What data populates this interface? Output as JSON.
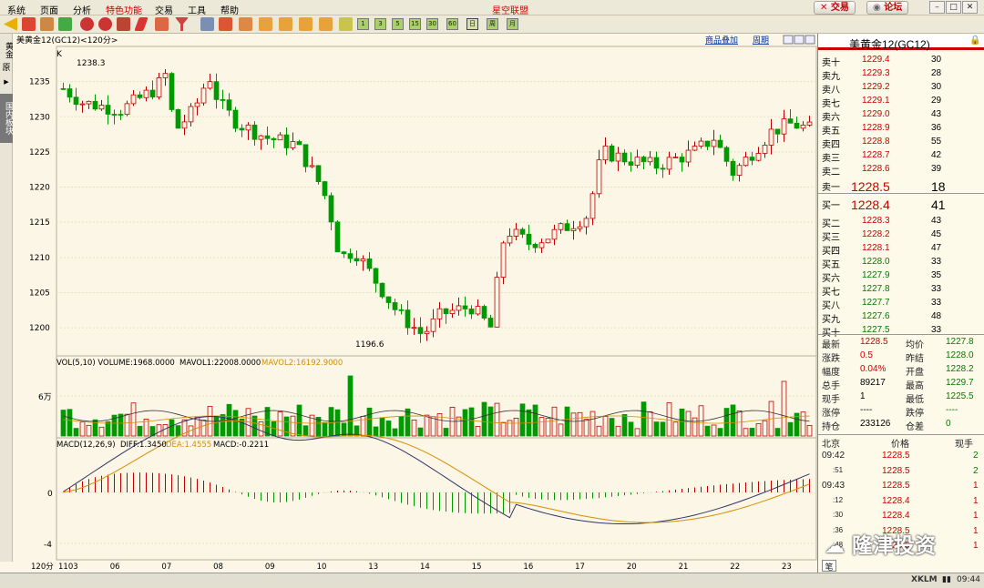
{
  "menu": {
    "items": [
      "系统",
      "页面",
      "分析",
      "特色功能",
      "交易",
      "工具",
      "帮助"
    ],
    "title": "星空联盟",
    "trade_btn": "交易",
    "forum_btn": "论坛"
  },
  "toolbar": {
    "periods": [
      "1",
      "3",
      "5",
      "15",
      "30",
      "60",
      "日",
      "周",
      "月"
    ]
  },
  "left_tabs": {
    "tab1": "黄金",
    "tab2": "原",
    "tab3": "国内板块"
  },
  "chart_header": {
    "title": "美黄金12(GC12)<120分>",
    "overlay": "商品叠加",
    "period": "周期",
    "k_label": "K"
  },
  "chart_data": [
    {
      "type": "candlestick",
      "title": "美黄金12(GC12)<120分>",
      "ylim": [
        1196,
        1240
      ],
      "yticks": [
        1200,
        1205,
        1210,
        1215,
        1220,
        1225,
        1230,
        1235
      ],
      "high_label": "1238.3",
      "low_label": "1196.6",
      "x_labels": [
        "1103",
        "06",
        "07",
        "08",
        "09",
        "10",
        "13",
        "14",
        "15",
        "16",
        "17",
        "20",
        "21",
        "22",
        "23"
      ]
    },
    {
      "type": "bar",
      "title": "VOL(5,10) VOLUME:1968.0000",
      "series": [
        {
          "name": "MAVOL1",
          "value": "22008.0000"
        },
        {
          "name": "MAVOL2",
          "value": "16192.9000"
        }
      ],
      "ytick": "6万"
    },
    {
      "type": "bar",
      "title": "MACD(12,26,9)",
      "series": [
        {
          "name": "DIFF",
          "value": "1.3450"
        },
        {
          "name": "DEA",
          "value": "1.4555"
        },
        {
          "name": "MACD",
          "value": "-0.2211"
        }
      ],
      "yticks": [
        "0",
        "-4"
      ]
    }
  ],
  "vol_header": {
    "label": "VOL(5,10) VOLUME:1968.0000",
    "mavol1": "MAVOL1:22008.0000",
    "mavol2": "MAVOL2:16192.9000",
    "tick": "6万"
  },
  "macd_header": {
    "label": "MACD(12,26,9)",
    "diff": "DIFF:1.3450",
    "dea": "DEA:1.4555",
    "macd": "MACD:-0.2211",
    "tick0": "0",
    "tick4": "-4"
  },
  "xaxis": {
    "period": "120分",
    "labels": [
      "1103",
      "06",
      "07",
      "08",
      "09",
      "10",
      "13",
      "14",
      "15",
      "16",
      "17",
      "20",
      "21",
      "22",
      "23"
    ]
  },
  "quote": {
    "name": "美黄金12(GC12)",
    "sell": [
      {
        "l": "卖十",
        "p": "1229.4",
        "v": "30"
      },
      {
        "l": "卖九",
        "p": "1229.3",
        "v": "28"
      },
      {
        "l": "卖八",
        "p": "1229.2",
        "v": "30"
      },
      {
        "l": "卖七",
        "p": "1229.1",
        "v": "29"
      },
      {
        "l": "卖六",
        "p": "1229.0",
        "v": "43"
      },
      {
        "l": "卖五",
        "p": "1228.9",
        "v": "36"
      },
      {
        "l": "卖四",
        "p": "1228.8",
        "v": "55"
      },
      {
        "l": "卖三",
        "p": "1228.7",
        "v": "42"
      },
      {
        "l": "卖二",
        "p": "1228.6",
        "v": "39"
      },
      {
        "l": "卖一",
        "p": "1228.5",
        "v": "18"
      }
    ],
    "buy": [
      {
        "l": "买一",
        "p": "1228.4",
        "v": "41"
      },
      {
        "l": "买二",
        "p": "1228.3",
        "v": "43"
      },
      {
        "l": "买三",
        "p": "1228.2",
        "v": "45"
      },
      {
        "l": "买四",
        "p": "1228.1",
        "v": "47"
      },
      {
        "l": "买五",
        "p": "1228.0",
        "v": "33"
      },
      {
        "l": "买六",
        "p": "1227.9",
        "v": "35"
      },
      {
        "l": "买七",
        "p": "1227.8",
        "v": "33"
      },
      {
        "l": "买八",
        "p": "1227.7",
        "v": "33"
      },
      {
        "l": "买九",
        "p": "1227.6",
        "v": "48"
      },
      {
        "l": "买十",
        "p": "1227.5",
        "v": "33"
      }
    ],
    "stats": [
      {
        "a": "最新",
        "av": "1228.5",
        "b": "均价",
        "bv": "1227.8"
      },
      {
        "a": "涨跌",
        "av": "0.5",
        "b": "昨结",
        "bv": "1228.0"
      },
      {
        "a": "幅度",
        "av": "0.04%",
        "b": "开盘",
        "bv": "1228.2"
      },
      {
        "a": "总手",
        "av": "89217",
        "b": "最高",
        "bv": "1229.7"
      },
      {
        "a": "现手",
        "av": "1",
        "b": "最低",
        "bv": "1225.5"
      },
      {
        "a": "涨停",
        "av": "----",
        "b": "跌停",
        "bv": "----"
      },
      {
        "a": "持仓",
        "av": "233126",
        "b": "仓差",
        "bv": "0"
      }
    ],
    "tick_header": {
      "a": "北京",
      "b": "价格",
      "c": "现手"
    },
    "ticks": [
      {
        "t": "09:42",
        "p": "1228.5",
        "v": "2"
      },
      {
        "t": ":51",
        "p": "1228.5",
        "v": "2"
      },
      {
        "t": "09:43",
        "p": "1228.5",
        "v": "1"
      },
      {
        "t": ":12",
        "p": "1228.4",
        "v": "1"
      },
      {
        "t": ":30",
        "p": "1228.4",
        "v": "1"
      },
      {
        "t": ":36",
        "p": "1228.5",
        "v": "1"
      },
      {
        "t": ":48",
        "p": "1228.5",
        "v": "1"
      }
    ],
    "bottom_tab": "笔"
  },
  "watermark": "隆津投资",
  "status": {
    "brand": "XKLM",
    "time": "09:44"
  },
  "colors": {
    "up": "#c00000",
    "down": "#00a000",
    "bg": "#fbf6e6"
  }
}
